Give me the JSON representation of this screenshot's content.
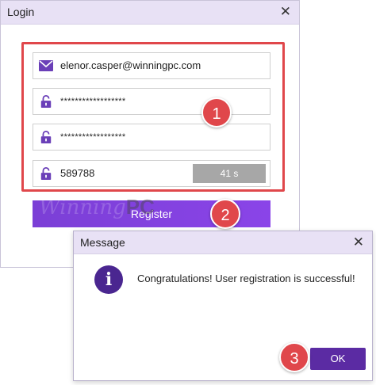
{
  "login": {
    "title": "Login",
    "close_glyph": "✕",
    "email": "elenor.casper@winningpc.com",
    "password": "******************",
    "confirm_password": "******************",
    "code": "589788",
    "timer": "41 s",
    "register_label": "Register",
    "watermark": {
      "part1": "Winning",
      "part2": "PC"
    }
  },
  "dialog": {
    "title": "Message",
    "close_glyph": "✕",
    "info_glyph": "i",
    "message": "Congratulations! User registration is successful!",
    "ok_label": "OK"
  },
  "steps": [
    "1",
    "2",
    "3"
  ],
  "colors": {
    "accent": "#7b3fd6",
    "titlebar": "#e8e1f5",
    "highlight": "#e0474b",
    "ok_button": "#5b2ba3"
  },
  "icons": {
    "email": "envelope-icon",
    "password": "lock-icon",
    "info": "info-icon"
  }
}
